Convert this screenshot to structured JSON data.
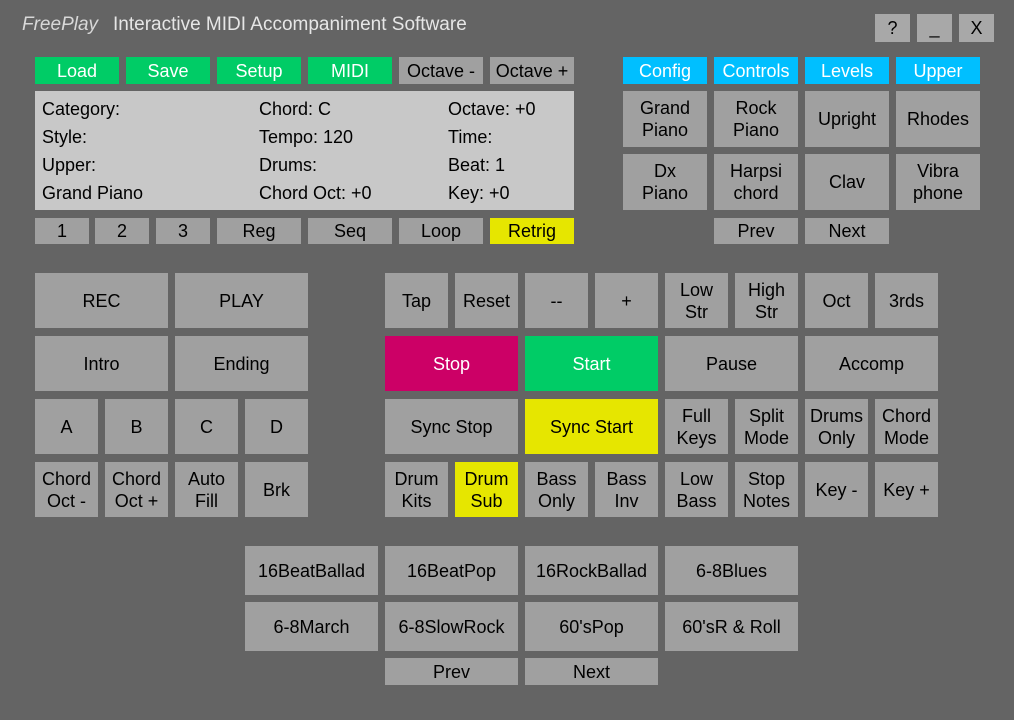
{
  "app": {
    "brand": "FreePlay",
    "subtitle": "Interactive MIDI Accompaniment Software"
  },
  "window_controls": {
    "help": "?",
    "minimize": "_",
    "close": "X"
  },
  "top_menu": {
    "load": "Load",
    "save": "Save",
    "setup": "Setup",
    "midi": "MIDI",
    "octave_minus": "Octave -",
    "octave_plus": "Octave +"
  },
  "info": {
    "category": "Category:",
    "style": "Style:",
    "upper": "Upper:",
    "instrument": "Grand Piano",
    "chord": "Chord: C",
    "tempo": "Tempo: 120",
    "drums": "Drums:",
    "chord_oct": "Chord Oct: +0",
    "octave": "Octave: +0",
    "time": "Time:",
    "beat": "Beat: 1",
    "key": "Key: +0"
  },
  "registration": {
    "one": "1",
    "two": "2",
    "three": "3",
    "reg": "Reg",
    "seq": "Seq",
    "loop": "Loop",
    "retrig": "Retrig"
  },
  "right_tabs": {
    "config": "Config",
    "controls": "Controls",
    "levels": "Levels",
    "upper": "Upper"
  },
  "instruments": {
    "grand_piano": "Grand\nPiano",
    "rock_piano": "Rock\nPiano",
    "upright": "Upright",
    "rhodes": "Rhodes",
    "dx_piano": "Dx\nPiano",
    "harpsichord": "Harpsi\nchord",
    "clav": "Clav",
    "vibraphone": "Vibra\nphone",
    "prev": "Prev",
    "next": "Next"
  },
  "left_controls": {
    "rec": "REC",
    "play": "PLAY",
    "intro": "Intro",
    "ending": "Ending",
    "a": "A",
    "b": "B",
    "c": "C",
    "d": "D",
    "chord_oct_minus": "Chord\nOct -",
    "chord_oct_plus": "Chord\nOct +",
    "auto_fill": "Auto\nFill",
    "brk": "Brk"
  },
  "main_controls": {
    "tap": "Tap",
    "reset": "Reset",
    "tempo_down": "--",
    "tempo_up": "+",
    "low_str": "Low\nStr",
    "high_str": "High\nStr",
    "oct": "Oct",
    "thirds": "3rds",
    "stop": "Stop",
    "start": "Start",
    "pause": "Pause",
    "accomp": "Accomp",
    "sync_stop": "Sync Stop",
    "sync_start": "Sync Start",
    "full_keys": "Full\nKeys",
    "split_mode": "Split\nMode",
    "drums_only": "Drums\nOnly",
    "chord_mode": "Chord\nMode",
    "drum_kits": "Drum\nKits",
    "drum_sub": "Drum\nSub",
    "bass_only": "Bass\nOnly",
    "bass_inv": "Bass\nInv",
    "low_bass": "Low\nBass",
    "stop_notes": "Stop\nNotes",
    "key_minus": "Key -",
    "key_plus": "Key +"
  },
  "styles": {
    "items": [
      "16BeatBallad",
      "16BeatPop",
      "16RockBallad",
      "6-8Blues",
      "6-8March",
      "6-8SlowRock",
      "60'sPop",
      "60'sR & Roll"
    ],
    "prev": "Prev",
    "next": "Next"
  },
  "colors": {
    "background": "#646464",
    "button": "#a0a0a0",
    "green": "#00cc66",
    "blue": "#00bfff",
    "yellow": "#e6e600",
    "pink": "#cc0066",
    "panel": "#c8c8c8"
  }
}
